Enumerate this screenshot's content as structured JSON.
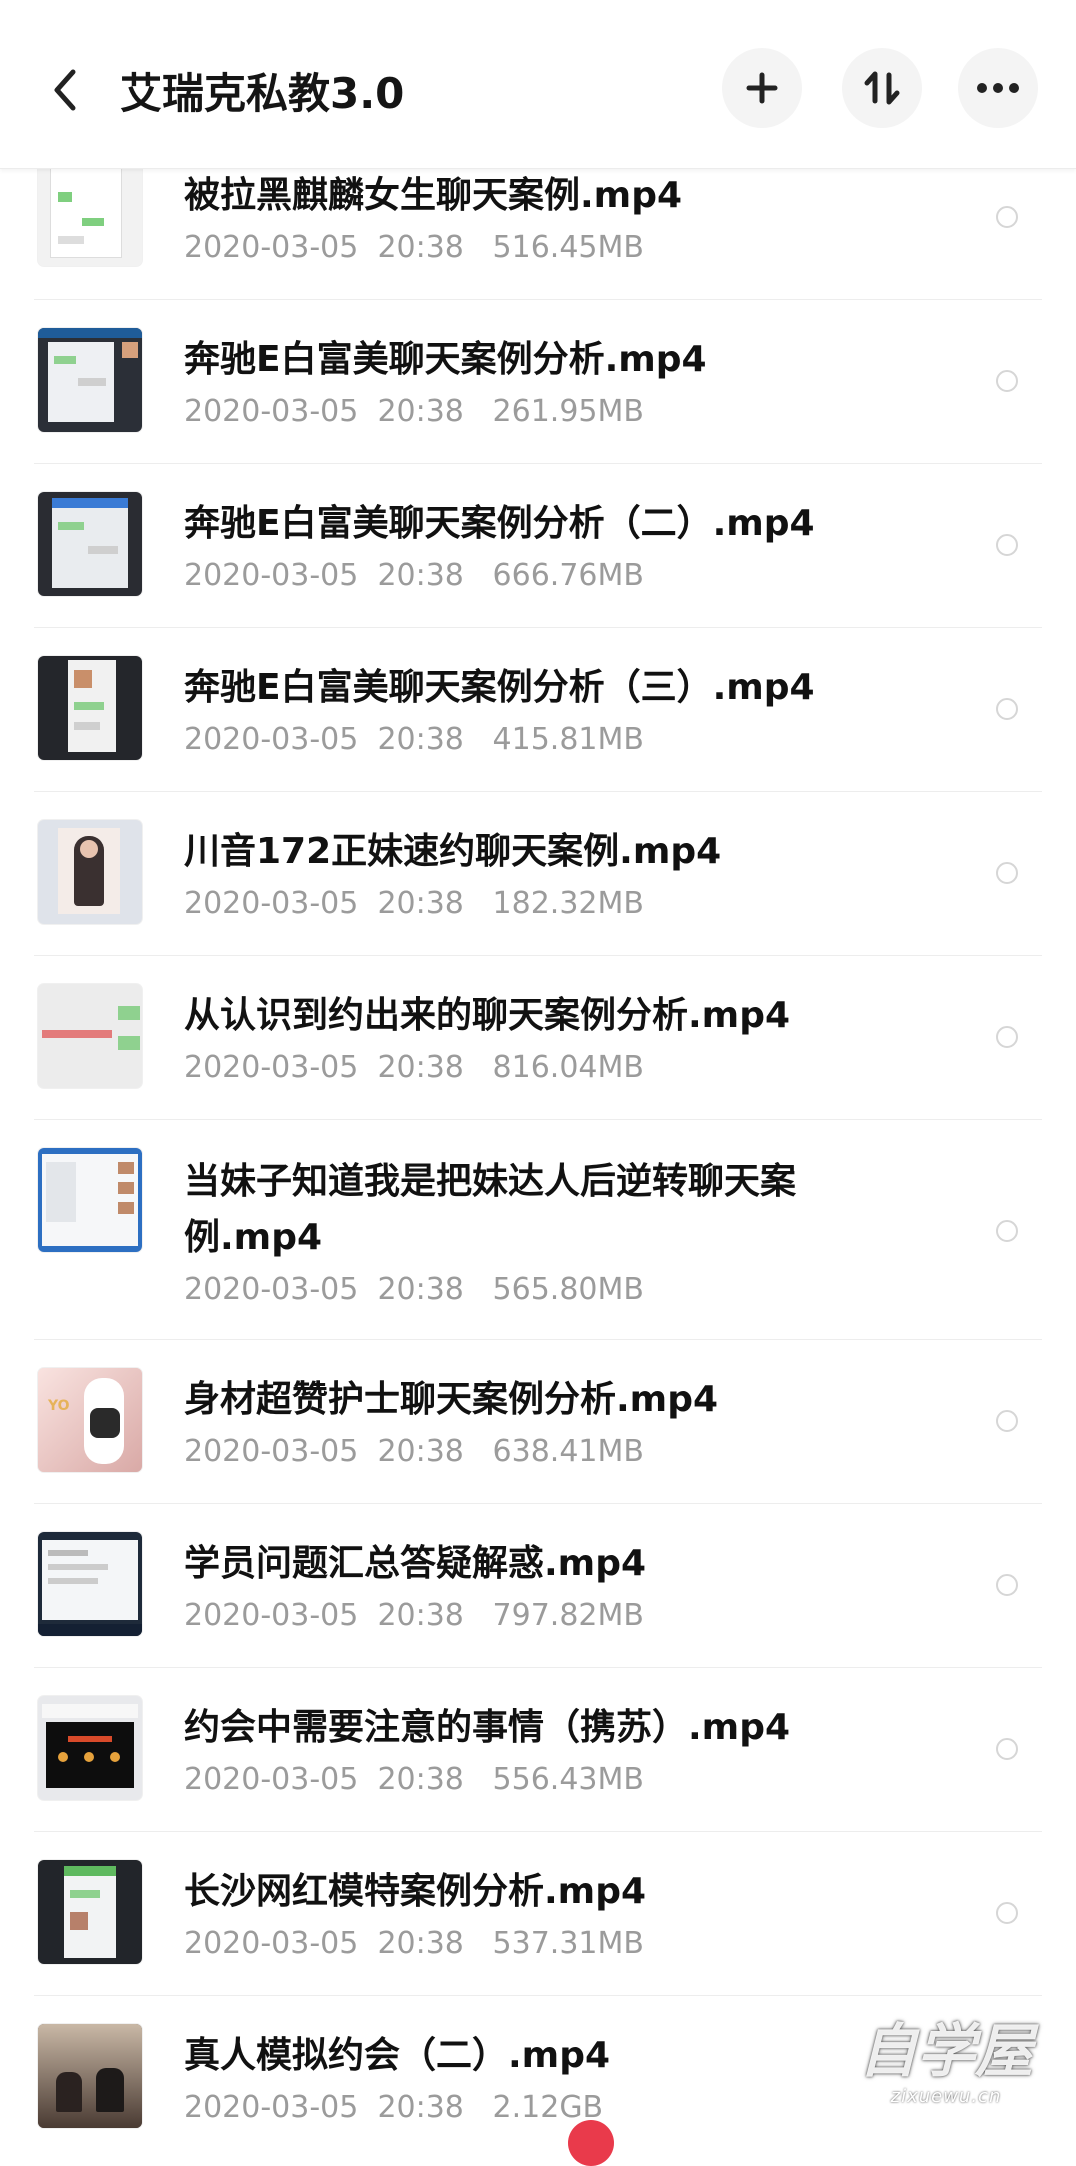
{
  "header": {
    "title": "艾瑞克私教3.0",
    "back_icon": "chevron-left-icon",
    "actions": [
      {
        "name": "add",
        "icon": "plus-icon"
      },
      {
        "name": "sort",
        "icon": "sort-icon"
      },
      {
        "name": "more",
        "icon": "more-icon"
      }
    ]
  },
  "files": [
    {
      "name": "被拉黑麒麟女生聊天案例.mp4",
      "date": "2020-03-05",
      "time": "20:38",
      "size": "516.45MB"
    },
    {
      "name": "奔驰E白富美聊天案例分析.mp4",
      "date": "2020-03-05",
      "time": "20:38",
      "size": "261.95MB"
    },
    {
      "name": "奔驰E白富美聊天案例分析（二）.mp4",
      "date": "2020-03-05",
      "time": "20:38",
      "size": "666.76MB"
    },
    {
      "name": "奔驰E白富美聊天案例分析（三）.mp4",
      "date": "2020-03-05",
      "time": "20:38",
      "size": "415.81MB"
    },
    {
      "name": "川音172正妹速约聊天案例.mp4",
      "date": "2020-03-05",
      "time": "20:38",
      "size": "182.32MB"
    },
    {
      "name": "从认识到约出来的聊天案例分析.mp4",
      "date": "2020-03-05",
      "time": "20:38",
      "size": "816.04MB"
    },
    {
      "name": "当妹子知道我是把妹达人后逆转聊天案例.mp4",
      "date": "2020-03-05",
      "time": "20:38",
      "size": "565.80MB"
    },
    {
      "name": "身材超赞护士聊天案例分析.mp4",
      "date": "2020-03-05",
      "time": "20:38",
      "size": "638.41MB"
    },
    {
      "name": "学员问题汇总答疑解惑.mp4",
      "date": "2020-03-05",
      "time": "20:38",
      "size": "797.82MB"
    },
    {
      "name": "约会中需要注意的事情（携苏）.mp4",
      "date": "2020-03-05",
      "time": "20:38",
      "size": "556.43MB"
    },
    {
      "name": "长沙网红模特案例分析.mp4",
      "date": "2020-03-05",
      "time": "20:38",
      "size": "537.31MB"
    },
    {
      "name": "真人模拟约会（二）.mp4",
      "date": "2020-03-05",
      "time": "20:38",
      "size": "2.12GB"
    }
  ],
  "watermark": {
    "main": "自学屋",
    "sub": "zixuewu.cn"
  },
  "colors": {
    "accent": "#e93a4b",
    "meta": "#9b9b9b",
    "separator": "#ededed"
  }
}
